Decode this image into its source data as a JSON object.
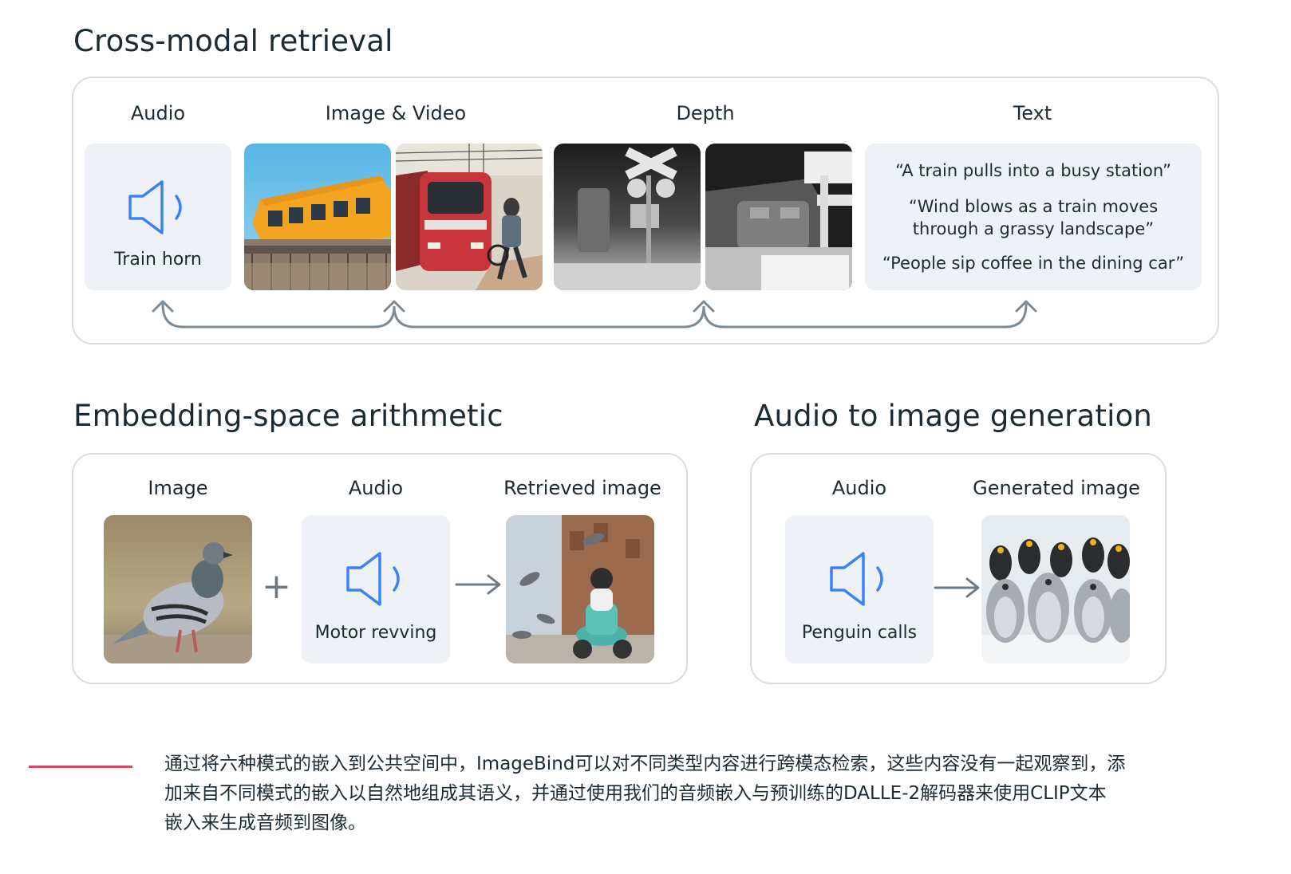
{
  "cross_modal": {
    "title": "Cross-modal retrieval",
    "labels": {
      "audio": "Audio",
      "image_video": "Image & Video",
      "depth": "Depth",
      "text": "Text"
    },
    "audio_caption": "Train horn",
    "text_quotes": [
      "“A train pulls into a busy station”",
      "“Wind blows as a train moves through a grassy landscape”",
      "“People sip coffee in the dining car”"
    ],
    "text_quote_lines": [
      [
        "“A train pulls into a busy station”"
      ],
      [
        "“Wind blows as a train moves",
        "through a grassy landscape”"
      ],
      [
        "“People sip coffee in the dining car”"
      ]
    ]
  },
  "arithmetic": {
    "title": "Embedding-space arithmetic",
    "labels": {
      "image": "Image",
      "audio": "Audio",
      "retrieved": "Retrieved image"
    },
    "audio_caption": "Motor revving",
    "plus": "+",
    "arrow": "→"
  },
  "generation": {
    "title": "Audio to image generation",
    "labels": {
      "audio": "Audio",
      "generated": "Generated image"
    },
    "audio_caption": "Penguin calls",
    "arrow": "→"
  },
  "footnote": {
    "lines": [
      "通过将六种模式的嵌入到公共空间中，ImageBind可以对不同类型内容进行跨模态检索，这些内容没有一起观察到，添",
      "加来自不同模式的嵌入以自然地组成其语义，并通过使用我们的音频嵌入与预训练的DALLE-2解码器来使用CLIP文本",
      "嵌入来生成音频到图像。"
    ],
    "accent_color": "#e0455f"
  },
  "colors": {
    "speaker": "#3b82f6",
    "tile_bg": "#eef2f6",
    "border": "#d6dde3",
    "arrow": "#6b7a86"
  }
}
